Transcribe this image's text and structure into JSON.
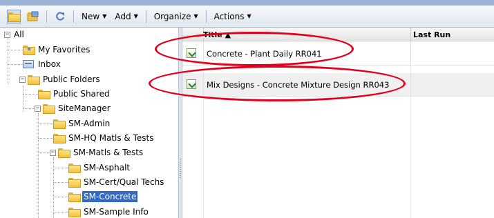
{
  "toolbar": {
    "menus": [
      "New",
      "Add",
      "Organize",
      "Actions"
    ],
    "icons": [
      "folder-view-icon",
      "folder-tree-icon",
      "refresh-icon"
    ]
  },
  "tree": {
    "root": "All",
    "my_favorites": "My Favorites",
    "inbox": "Inbox",
    "public_folders": "Public Folders",
    "public_shared": "Public Shared",
    "sitemanager": "SiteManager",
    "sm_admin": "SM-Admin",
    "sm_hq": "SM-HQ Matls & Tests",
    "sm_matls": "SM-Matls & Tests",
    "sm_asphalt": "SM-Asphalt",
    "sm_cert": "SM-Cert/Qual Techs",
    "sm_concrete": "SM-Concrete",
    "sm_sample": "SM-Sample Info",
    "toggle_minus": "−"
  },
  "grid": {
    "columns": {
      "title": "Title ▲",
      "last_run": "Last Run"
    },
    "rows": [
      {
        "title": "Concrete - Plant Daily  RR041"
      },
      {
        "title": "Mix Designs - Concrete Mixture Design  RR043"
      }
    ]
  },
  "colors": {
    "selection": "#316ac5",
    "annotation": "#e3001b",
    "toolbar_top": "#9bb3d4"
  }
}
